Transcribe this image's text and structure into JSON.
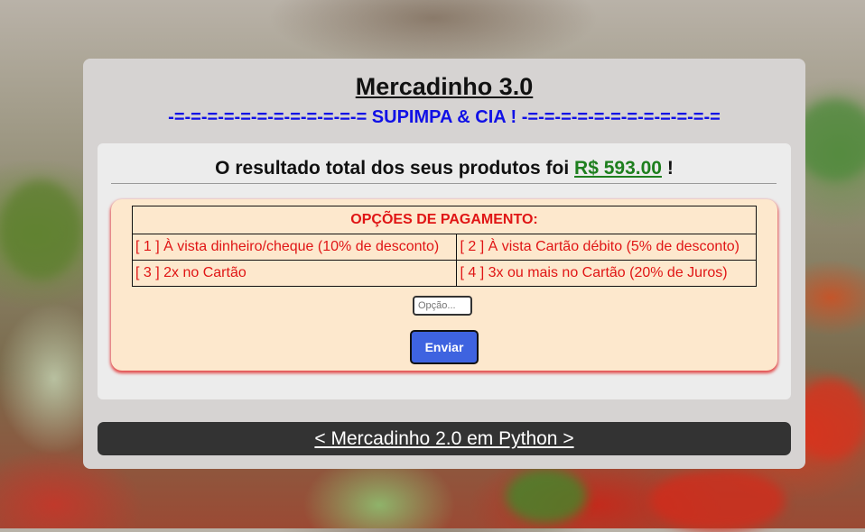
{
  "header": {
    "title": "Mercadinho 3.0",
    "subtitle": "-=-=-=-=-=-=-=-=-=-=-=-= SUPIMPA & CIA ! -=-=-=-=-=-=-=-=-=-=-=-="
  },
  "result": {
    "prefix": "O resultado total dos seus produtos foi",
    "total": "R$ 593.00",
    "suffix": "!"
  },
  "payment": {
    "heading": "OPÇÕES DE PAGAMENTO:",
    "options": [
      "[ 1 ] À vista dinheiro/cheque (10% de desconto)",
      "[ 2 ] À vista Cartão débito (5% de desconto)",
      "[ 3 ] 2x no Cartão",
      "[ 4 ] 3x ou mais no Cartão (20% de Juros)"
    ],
    "input_placeholder": "Opção...",
    "submit_label": "Enviar"
  },
  "footer": {
    "link_label": "< Mercadinho 2.0 em Python >"
  },
  "colors": {
    "accent_blue": "#1010e6",
    "price_green": "#1e7f1e",
    "option_red": "#e01515",
    "button_blue": "#3e63e0",
    "footer_dark": "#333333"
  }
}
